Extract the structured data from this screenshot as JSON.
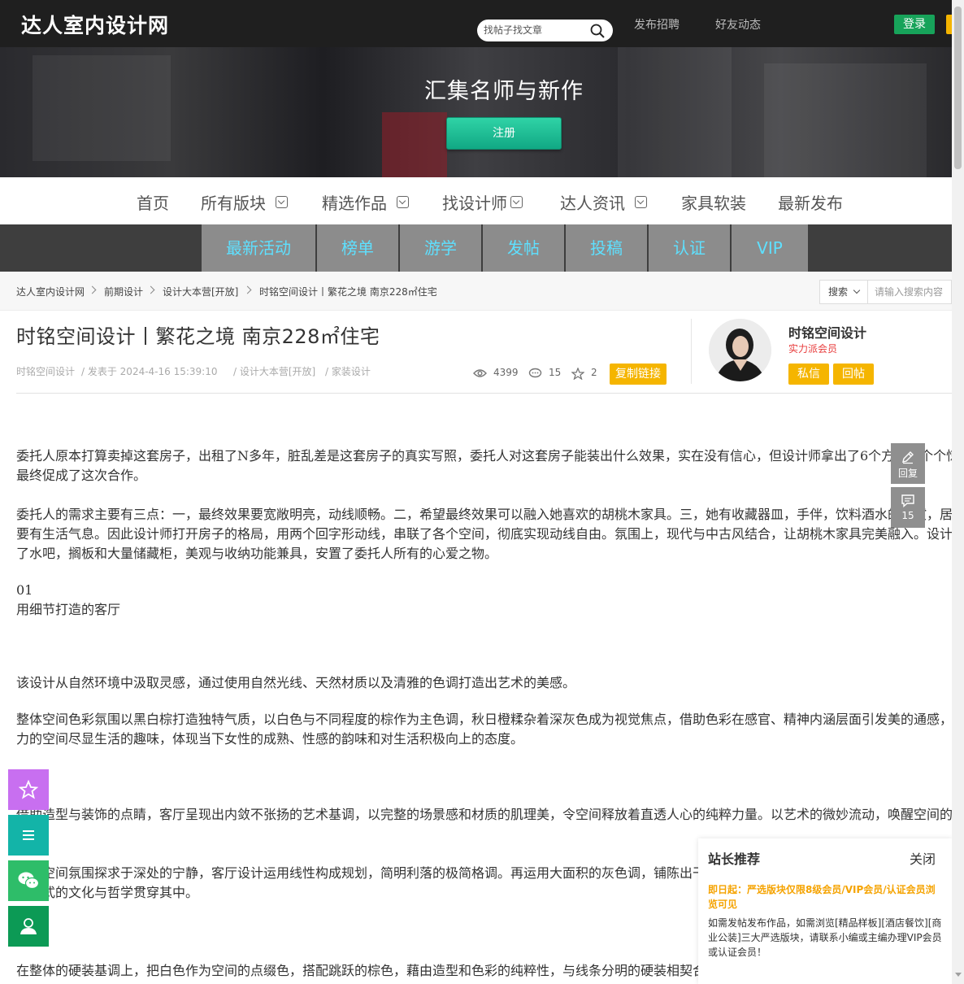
{
  "header": {
    "logo": "达人室内设计网",
    "search_placeholder": "找帖子找文章",
    "links": [
      "发布招聘",
      "好友动态"
    ],
    "login_label": "登录"
  },
  "banner": {
    "title": "汇集名师与新作",
    "register_label": "注册"
  },
  "main_nav": [
    {
      "label": "首页",
      "dropdown": false
    },
    {
      "label": "所有版块",
      "dropdown": true
    },
    {
      "label": "精选作品",
      "dropdown": true
    },
    {
      "label": "找设计师",
      "dropdown": true
    },
    {
      "label": "达人资讯",
      "dropdown": true
    },
    {
      "label": "家具软装",
      "dropdown": false
    },
    {
      "label": "最新发布",
      "dropdown": false
    }
  ],
  "sub_nav": [
    "最新活动",
    "榜单",
    "游学",
    "发帖",
    "投稿",
    "认证",
    "VIP"
  ],
  "breadcrumb": [
    "达人室内设计网",
    "前期设计",
    "设计大本营[开放]",
    "时铭空间设计丨繁花之境 南京228㎡住宅"
  ],
  "search_bar": {
    "select_label": "搜索",
    "placeholder": "请输入搜索内容"
  },
  "post": {
    "title": "时铭空间设计丨繁花之境 南京228㎡住宅",
    "author": "时铭空间设计",
    "posted": "/ 发表于 2024-4-16 15:39:10",
    "forum": "/ 设计大本营[开放]",
    "tag": "/ 家装设计",
    "views": "4399",
    "replies": "15",
    "favorites": "2",
    "copy_link_label": "复制链接"
  },
  "author_card": {
    "name": "时铭空间设计",
    "level": "实力派会员",
    "message_label": "私信",
    "reply_label": "回帖"
  },
  "side_tools": {
    "reply_label": "回复",
    "comment_count": "15"
  },
  "content": [
    "委托人原本打算卖掉这套房子，出租了N多年，脏乱差是这套房子的真实写照，委托人对这套房子能装出什么效果，实在没有信心，但设计师拿出了6个方案，个个惊艳，",
    "最终促成了这次合作。",
    "委托人的需求主要有三点：一，最终效果要宽敞明亮，动线顺畅。二，希望最终效果可以融入她喜欢的胡桃木家具。三，她有收藏器皿，手伴，饮料酒水的习惯，居住空间",
    "要有生活气息。因此设计师打开房子的格局，用两个回字形动线，串联了各个空间，彻底实现动线自由。氛围上，现代与中古风结合，让胡桃木家具完美融入。设计师还做",
    "了水吧，搁板和大量储藏柜，美观与收纳功能兼具，安置了委托人所有的心爱之物。",
    "01",
    "用细节打造的客厅",
    "该设计从自然环境中汲取灵感，通过使用自然光线、天然材质以及清雅的色调打造出艺术的美感。",
    "整体空间色彩氛围以黑白棕打造独特气质，以白色与不同程度的棕作为主色调，秋日橙糅杂着深灰色成为视觉焦点，借助色彩在感官、精神内涵层面引发美的通感，以富有张",
    "力的空间尽显生活的趣味，体现当下女性的成熟、性感的韵味和对生活积极向上的态度。",
    "借助造型与装饰的点睛，客厅呈现出内敛不张扬的艺术基调，以完整的场景感和材质的肌理美，令空间释放着直透人心的纯粹力量。以艺术的微妙流动，唤醒空间的灵性。",
    "客厅空间氛围探求于深处的宁静，客厅设计运用线性构成规划，简明利落的极简格调。再运用大面积的灰色调，铺陈出干净利落的空间质感，将东方美学与现代简约的设计融合，",
    "将仪式的文化与哲学贯穿其中。",
    "在整体的硬装基调上，把白色作为空间的点缀色，搭配跳跃的棕色，藉由造型和色彩的纯粹性，与线条分明的硬装相契合。"
  ],
  "recommend": {
    "title": "站长推荐",
    "close_label": "关闭",
    "highlight": "即日起：严选版块仅限8级会员/VIP会员/认证会员浏览可见",
    "body": "如需发帖发布作品，如需浏览[精品样板][酒店餐饮][商业公装]三大严选版块，请联系小编或主编办理VIP会员或认证会员！"
  },
  "colors": {
    "topbar": "#1f1f1f",
    "login_green": "#17a35a",
    "register_teal": "#1fbf96",
    "subnav_text": "#5ee0ff",
    "accent_yellow": "#f5b500",
    "level_red": "#e83c3c",
    "float_purple": "#c86ff0",
    "float_teal": "#13b4a8",
    "float_green": "#2ebd69",
    "float_darkgreen": "#0c9a55"
  }
}
